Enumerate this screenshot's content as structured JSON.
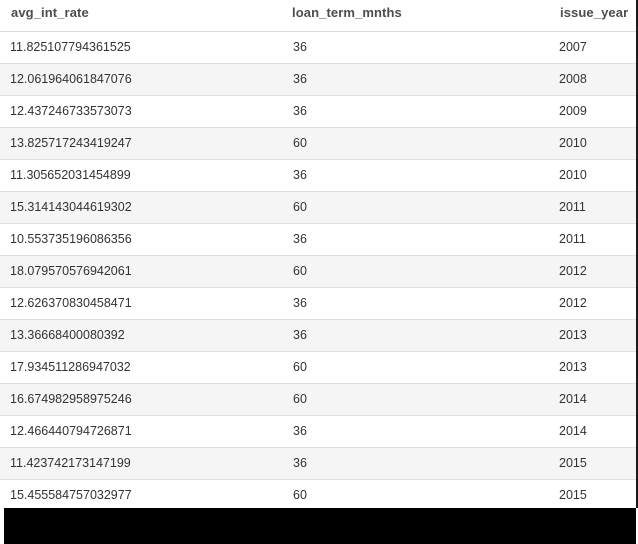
{
  "table": {
    "columns": [
      "avg_int_rate",
      "loan_term_mnths",
      "issue_year"
    ],
    "rows": [
      [
        "11.825107794361525",
        "36",
        "2007"
      ],
      [
        "12.061964061847076",
        "36",
        "2008"
      ],
      [
        "12.437246733573073",
        "36",
        "2009"
      ],
      [
        "13.825717243419247",
        "60",
        "2010"
      ],
      [
        "11.305652031454899",
        "36",
        "2010"
      ],
      [
        "15.314143044619302",
        "60",
        "2011"
      ],
      [
        "10.553735196086356",
        "36",
        "2011"
      ],
      [
        "18.079570576942061",
        "60",
        "2012"
      ],
      [
        "12.626370830458471",
        "36",
        "2012"
      ],
      [
        "13.36668400080392",
        "36",
        "2013"
      ],
      [
        "17.934511286947032",
        "60",
        "2013"
      ],
      [
        "16.674982958975246",
        "60",
        "2014"
      ],
      [
        "12.466440794726871",
        "36",
        "2014"
      ],
      [
        "11.423742173147199",
        "36",
        "2015"
      ],
      [
        "15.455584757032977",
        "60",
        "2015"
      ]
    ]
  },
  "colors": {
    "header_text": "#4d4d4d",
    "cell_text": "#333333",
    "alt_row_bg": "#f5f5f5",
    "bottom_bar": "#000000"
  }
}
